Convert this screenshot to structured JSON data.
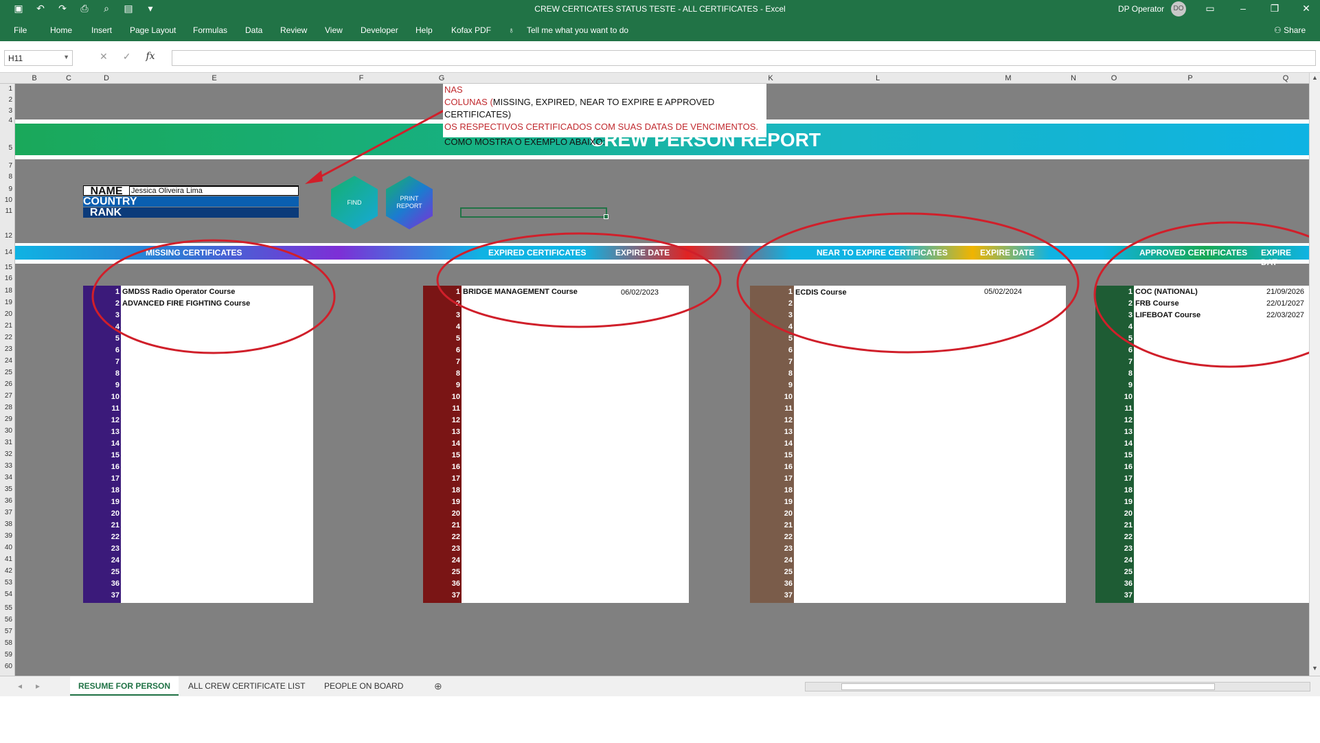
{
  "window": {
    "title": "CREW CERTICATES STATUS TESTE - ALL CERTIFICATES  -  Excel",
    "user": "DP Operator",
    "avatar_initials": "DO",
    "share": "Share"
  },
  "menu": [
    "File",
    "Home",
    "Insert",
    "Page Layout",
    "Formulas",
    "Data",
    "Review",
    "View",
    "Developer",
    "Help",
    "Kofax PDF",
    "Tell me what you want to do"
  ],
  "formula_bar": {
    "name_box": "H11",
    "fx": "fx"
  },
  "columns": [
    "B",
    "C",
    "D",
    "E",
    "F",
    "G",
    "K",
    "L",
    "M",
    "N",
    "O",
    "P",
    "Q"
  ],
  "rows": [
    "1",
    "2",
    "3",
    "4",
    "5",
    "7",
    "8",
    "9",
    "10",
    "11",
    "12",
    "14",
    "15",
    "16",
    "18",
    "19",
    "20",
    "21",
    "22",
    "23",
    "24",
    "25",
    "26",
    "27",
    "28",
    "29",
    "30",
    "31",
    "32",
    "33",
    "34",
    "35",
    "36",
    "37",
    "38",
    "39",
    "40",
    "41",
    "42",
    "53",
    "54",
    "55",
    "56",
    "57",
    "58",
    "59",
    "60"
  ],
  "note": {
    "line1": "SELECIONAR O NOME DO TRIPULANTE EM QUESTAO, PARA APARECER NAS",
    "line2a": "COLUNAS (",
    "line2b": "MISSING, EXPIRED, NEAR TO EXPIRE E APPROVED CERTIFICATES)",
    "line3": "OS RESPECTIVOS CERTIFICADOS COM SUAS DATAS DE VENCIMENTOS.",
    "line4": "COMO MOSTRA O EXEMPLO ABAIXO:"
  },
  "report_title": "CREW PERSON REPORT",
  "info": {
    "name_label": "NAME",
    "name_value": "Jessica Oliveira Lima",
    "country_label": "COUNTRY",
    "rank_label": "RANK"
  },
  "buttons": {
    "find": "FIND",
    "print_line1": "PRINT",
    "print_line2": "REPORT"
  },
  "sections": {
    "missing": "MISSING CERTIFICATES",
    "expired": "EXPIRED CERTIFICATES",
    "expire_date": "EXPIRE DATE",
    "near": "NEAR TO EXPIRE CERTIFICATES",
    "approved": "APPROVED CERTIFICATES",
    "approved_date": "EXPIRE DAT"
  },
  "numbers": [
    "1",
    "2",
    "3",
    "4",
    "5",
    "6",
    "7",
    "8",
    "9",
    "10",
    "11",
    "12",
    "13",
    "14",
    "15",
    "16",
    "17",
    "18",
    "19",
    "20",
    "21",
    "22",
    "23",
    "24",
    "25",
    "36",
    "37"
  ],
  "missing_certs": [
    "GMDSS Radio Operator Course",
    "ADVANCED FIRE FIGHTING Course"
  ],
  "expired_certs": [
    {
      "name": "BRIDGE MANAGEMENT Course",
      "date": "06/02/2023"
    }
  ],
  "near_certs": [
    {
      "name": "ECDIS Course",
      "date": "05/02/2024"
    }
  ],
  "approved_certs": [
    {
      "name": "COC (NATIONAL)",
      "date": "21/09/2026"
    },
    {
      "name": "FRB Course",
      "date": "22/01/2027"
    },
    {
      "name": "LIFEBOAT Course",
      "date": "22/03/2027"
    }
  ],
  "tabs": [
    "RESUME FOR PERSON",
    "ALL CREW CERTIFICATE LIST",
    "PEOPLE ON BOARD"
  ],
  "colors": {
    "excel_green": "#217346",
    "missing": "#3b1a7a",
    "expired": "#7a1515",
    "near": "#7a5c4a",
    "approved": "#1e5c34",
    "annotation_red": "#d01f2a"
  }
}
